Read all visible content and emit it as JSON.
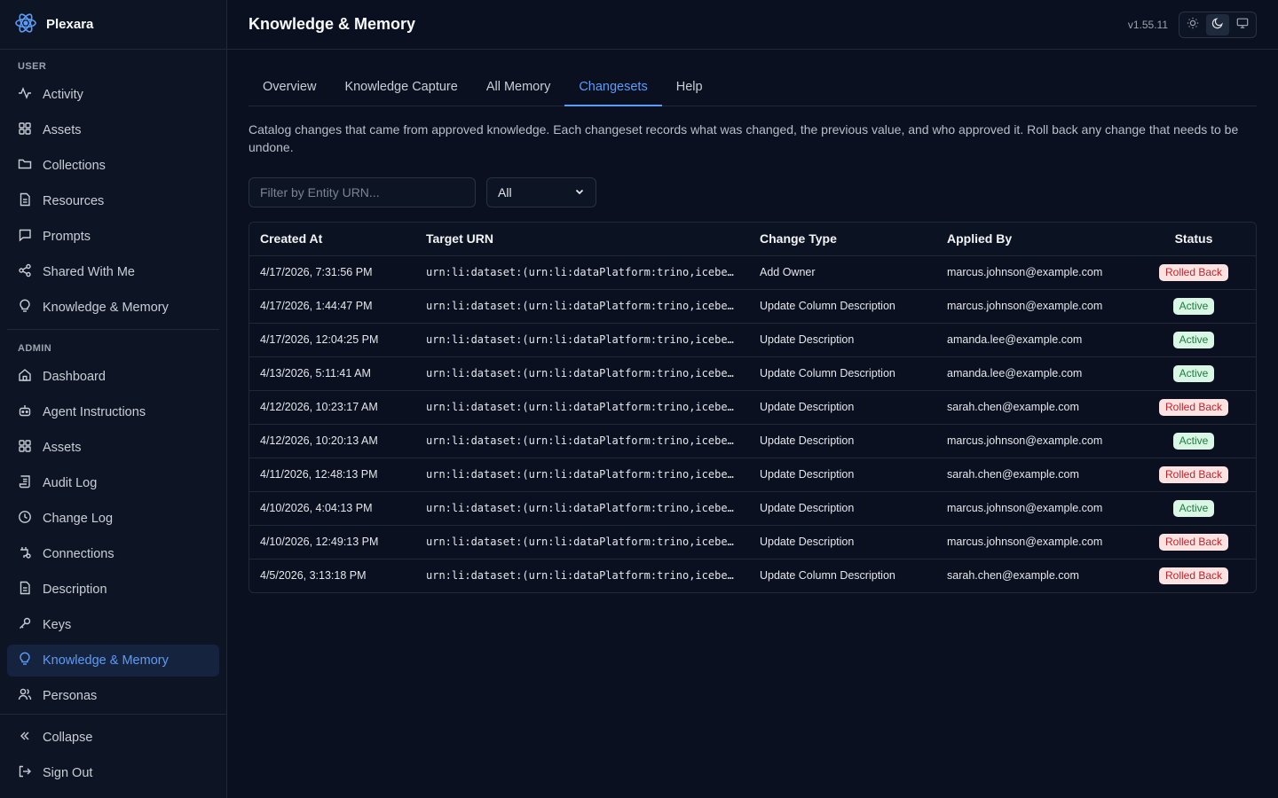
{
  "app": {
    "name": "Plexara",
    "version": "v1.55.11"
  },
  "sidebar": {
    "user_label": "USER",
    "user_items": [
      {
        "label": "Activity",
        "icon": "activity-icon"
      },
      {
        "label": "Assets",
        "icon": "grid-icon"
      },
      {
        "label": "Collections",
        "icon": "folder-icon"
      },
      {
        "label": "Resources",
        "icon": "file-icon"
      },
      {
        "label": "Prompts",
        "icon": "message-icon"
      },
      {
        "label": "Shared With Me",
        "icon": "share-icon"
      },
      {
        "label": "Knowledge & Memory",
        "icon": "lightbulb-icon"
      }
    ],
    "admin_label": "ADMIN",
    "admin_items": [
      {
        "label": "Dashboard",
        "icon": "home-icon"
      },
      {
        "label": "Agent Instructions",
        "icon": "bot-icon"
      },
      {
        "label": "Assets",
        "icon": "grid-icon"
      },
      {
        "label": "Audit Log",
        "icon": "scroll-icon"
      },
      {
        "label": "Change Log",
        "icon": "clock-icon"
      },
      {
        "label": "Connections",
        "icon": "plug-icon"
      },
      {
        "label": "Description",
        "icon": "file-icon"
      },
      {
        "label": "Keys",
        "icon": "key-icon"
      },
      {
        "label": "Knowledge & Memory",
        "icon": "lightbulb-icon",
        "active": true
      },
      {
        "label": "Personas",
        "icon": "users-icon"
      }
    ],
    "collapse_label": "Collapse",
    "signout_label": "Sign Out"
  },
  "header": {
    "title": "Knowledge & Memory"
  },
  "tabs": [
    {
      "label": "Overview"
    },
    {
      "label": "Knowledge Capture"
    },
    {
      "label": "All Memory"
    },
    {
      "label": "Changesets",
      "active": true
    },
    {
      "label": "Help"
    }
  ],
  "description": "Catalog changes that came from approved knowledge. Each changeset records what was changed, the previous value, and who approved it. Roll back any change that needs to be undone.",
  "filters": {
    "urn_placeholder": "Filter by Entity URN...",
    "status_value": "All"
  },
  "table": {
    "headers": [
      "Created At",
      "Target URN",
      "Change Type",
      "Applied By",
      "Status"
    ],
    "rows": [
      {
        "created": "4/17/2026, 7:31:56 PM",
        "urn": "urn:li:dataset:(urn:li:dataPlatform:trino,icebe…",
        "type": "Add Owner",
        "by": "marcus.johnson@example.com",
        "status": "Rolled Back",
        "kind": "rolled"
      },
      {
        "created": "4/17/2026, 1:44:47 PM",
        "urn": "urn:li:dataset:(urn:li:dataPlatform:trino,icebe…",
        "type": "Update Column Description",
        "by": "marcus.johnson@example.com",
        "status": "Active",
        "kind": "active"
      },
      {
        "created": "4/17/2026, 12:04:25 PM",
        "urn": "urn:li:dataset:(urn:li:dataPlatform:trino,icebe…",
        "type": "Update Description",
        "by": "amanda.lee@example.com",
        "status": "Active",
        "kind": "active"
      },
      {
        "created": "4/13/2026, 5:11:41 AM",
        "urn": "urn:li:dataset:(urn:li:dataPlatform:trino,icebe…",
        "type": "Update Column Description",
        "by": "amanda.lee@example.com",
        "status": "Active",
        "kind": "active"
      },
      {
        "created": "4/12/2026, 10:23:17 AM",
        "urn": "urn:li:dataset:(urn:li:dataPlatform:trino,icebe…",
        "type": "Update Description",
        "by": "sarah.chen@example.com",
        "status": "Rolled Back",
        "kind": "rolled"
      },
      {
        "created": "4/12/2026, 10:20:13 AM",
        "urn": "urn:li:dataset:(urn:li:dataPlatform:trino,icebe…",
        "type": "Update Description",
        "by": "marcus.johnson@example.com",
        "status": "Active",
        "kind": "active"
      },
      {
        "created": "4/11/2026, 12:48:13 PM",
        "urn": "urn:li:dataset:(urn:li:dataPlatform:trino,icebe…",
        "type": "Update Description",
        "by": "sarah.chen@example.com",
        "status": "Rolled Back",
        "kind": "rolled"
      },
      {
        "created": "4/10/2026, 4:04:13 PM",
        "urn": "urn:li:dataset:(urn:li:dataPlatform:trino,icebe…",
        "type": "Update Description",
        "by": "marcus.johnson@example.com",
        "status": "Active",
        "kind": "active"
      },
      {
        "created": "4/10/2026, 12:49:13 PM",
        "urn": "urn:li:dataset:(urn:li:dataPlatform:trino,icebe…",
        "type": "Update Description",
        "by": "marcus.johnson@example.com",
        "status": "Rolled Back",
        "kind": "rolled"
      },
      {
        "created": "4/5/2026, 3:13:18 PM",
        "urn": "urn:li:dataset:(urn:li:dataPlatform:trino,icebe…",
        "type": "Update Column Description",
        "by": "sarah.chen@example.com",
        "status": "Rolled Back",
        "kind": "rolled"
      }
    ]
  },
  "colors": {
    "accent": "#5b9cf6",
    "background": "#0a1020",
    "sidebar": "#0d1525",
    "rolled_back_bg": "#fde2e2",
    "rolled_back_fg": "#c0242c",
    "active_bg": "#d9f7e4",
    "active_fg": "#17803d"
  }
}
